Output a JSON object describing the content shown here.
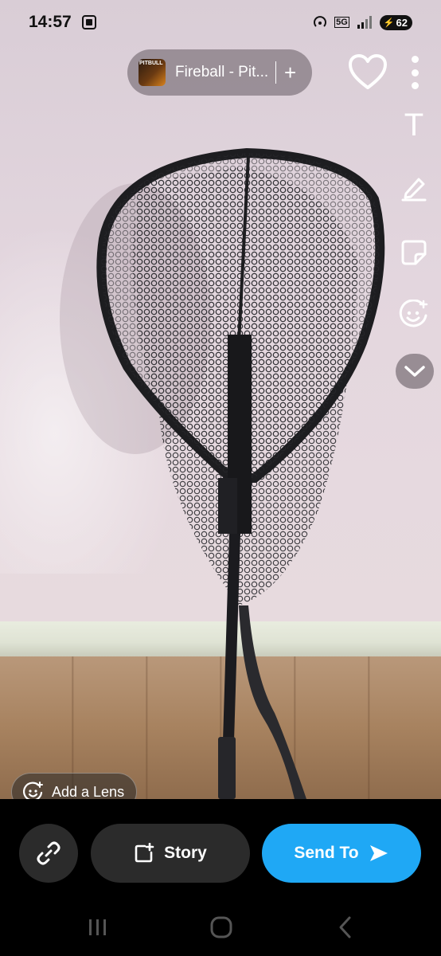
{
  "status_bar": {
    "time": "14:57",
    "network": "5G",
    "battery": "62"
  },
  "sound": {
    "artist_art_text": "PITBULL",
    "title": "Fireball - Pit...",
    "add_symbol": "+"
  },
  "tools": {
    "text_tool": "T"
  },
  "lens": {
    "label": "Add a Lens"
  },
  "actions": {
    "story_label": "Story",
    "send_label": "Send To"
  },
  "colors": {
    "send_button": "#1fa8f5",
    "pill_dark": "#2b2b2b"
  },
  "icons": [
    "screenshot-icon",
    "hotspot-icon",
    "signal-icon",
    "heart-icon",
    "more-vertical-icon",
    "text-icon",
    "pencil-icon",
    "sticker-icon",
    "emoji-icon",
    "chevron-down-icon",
    "lens-icon",
    "link-icon",
    "story-add-icon",
    "send-arrow-icon",
    "recents-icon",
    "home-icon",
    "back-icon"
  ]
}
